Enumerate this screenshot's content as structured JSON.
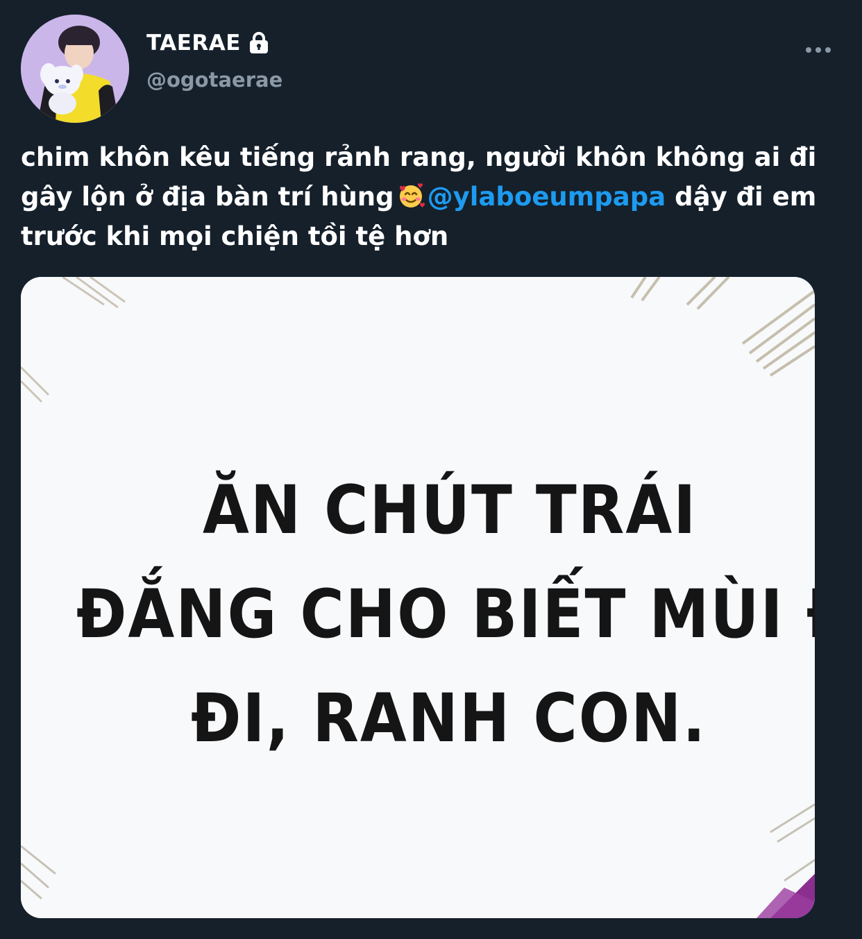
{
  "user": {
    "display_name": "TAERAE",
    "handle": "@ogotaerae",
    "protected_icon": "lock-icon",
    "avatar_icon": "profile-avatar"
  },
  "more_icon": "more-horizontal-icon",
  "tweet": {
    "line1": "chim khôn kêu tiếng rảnh rang, người khôn không ai đi",
    "line2_before": "gây lộn ở địa bàn trí hùng",
    "emoji": "smiling-face-with-hearts-emoji",
    "line2_mention": "@ylaboeumpapa",
    "line2_after": "dậy đi em",
    "line3": "trước khi mọi chiện tồi tệ hơn"
  },
  "media": {
    "caption_line1": "ĂN CHÚT TRÁI",
    "caption_line2": "ĐẮNG CHO BIẾT MÙI ĐỜI",
    "caption_line3": "ĐI, RANH CON."
  },
  "colors": {
    "background": "#15202b",
    "text": "#ffffff",
    "secondary": "#8b98a5",
    "link": "#1d9bf0"
  }
}
